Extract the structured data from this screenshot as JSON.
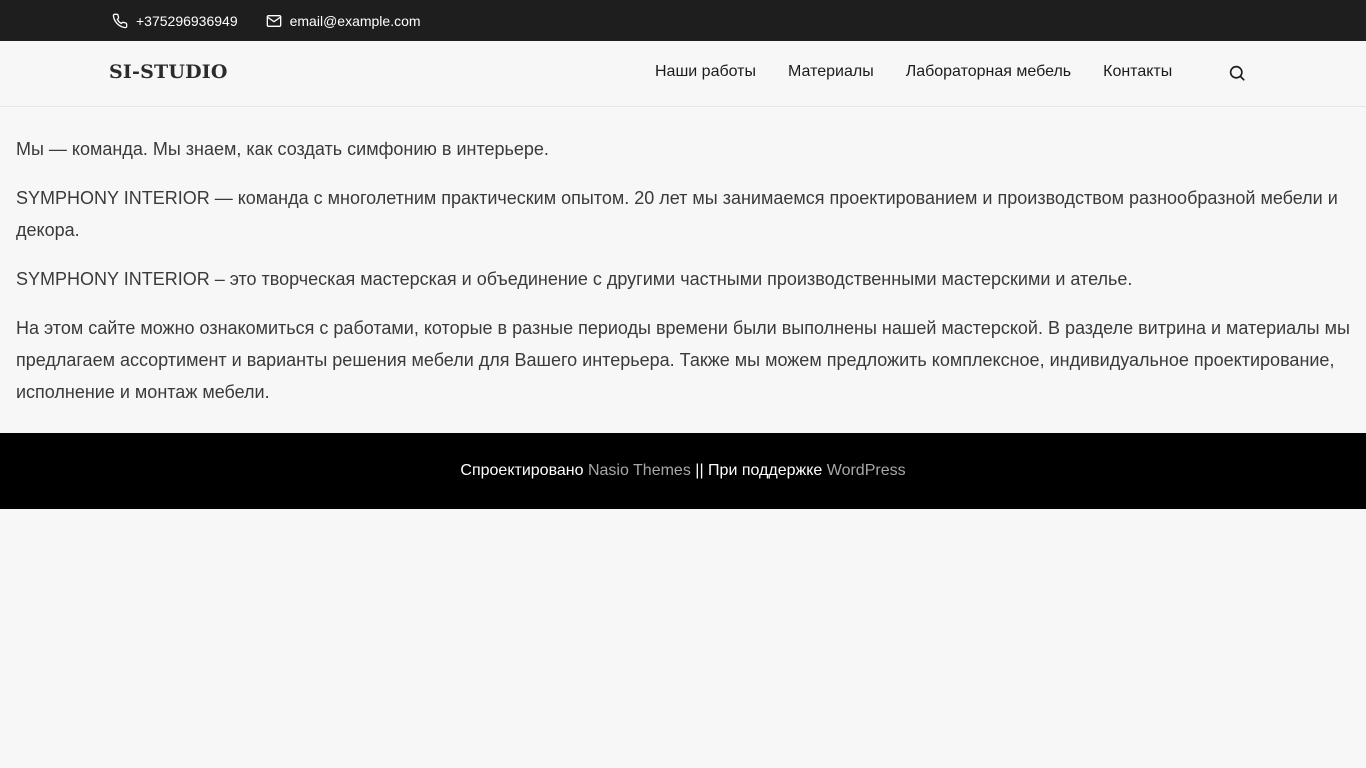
{
  "topbar": {
    "phone": "+375296936949",
    "email": "email@example.com"
  },
  "header": {
    "logo": "SI-STUDIO",
    "nav": [
      "Наши работы",
      "Материалы",
      "Лабораторная мебель",
      "Контакты"
    ]
  },
  "content": {
    "paragraphs": [
      "Мы — команда. Мы знаем, как создать симфонию в интерьере.",
      "SYMPHONY INTERIOR — команда с многолетним практическим опытом. 20 лет мы занимаемся проектированием и производством разнообразной мебели и декора.",
      "SYMPHONY INTERIOR – это творческая мастерская и объединение с другими частными производственными мастерскими и ателье.",
      "На этом сайте можно ознакомиться с работами, которые в разные периоды времени были выполнены нашей мастерской.  В разделе витрина и материалы мы предлагаем ассортимент и варианты решения мебели для Вашего интерьера. Также мы можем предложить комплексное, индивидуальное проектирование, исполнение и монтаж мебели."
    ]
  },
  "footer": {
    "designed_by": "Спроектировано",
    "theme_link": "Nasio Themes",
    "separator": "||",
    "powered_by": "При поддержке",
    "wp_link": "WordPress"
  },
  "colors": {
    "topbar_bg": "#1e1e1e",
    "page_bg": "#f7f7f7",
    "footer_bg": "#000000",
    "link_muted": "#a7a7a7"
  }
}
